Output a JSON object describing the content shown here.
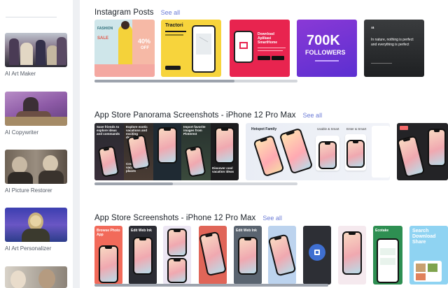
{
  "sidebar": {
    "items": [
      {
        "label": "AI Art Maker"
      },
      {
        "label": "AI Copywriter"
      },
      {
        "label": "AI Picture Restorer"
      },
      {
        "label": "AI Art Personalizer"
      },
      {
        "label": ""
      }
    ]
  },
  "sections": [
    {
      "title": "Instagram Posts",
      "see_all": "See all",
      "cards": {
        "fashion_sale": {
          "tag": "FASHION",
          "sub": "SALE",
          "discount": "40%",
          "off": "OFF"
        },
        "tractori": {
          "brand": "Tractori"
        },
        "download": {
          "headline": "Download Aplikasi SmartHome"
        },
        "followers": {
          "count": "700K",
          "label": "FOLLOWERS"
        },
        "quote": {
          "text": "In nature, nothing is perfect and everything is perfect"
        }
      }
    },
    {
      "title": "App Store Panorama Screenshots - iPhone 12 Pro Max",
      "see_all": "See all",
      "cards": {
        "panel_texts": [
          "Save friends to explore ideas and commands",
          "Explore exotic vacations and exciting destinations",
          "Import favorite images from Pinterest",
          "Create new vacations and places",
          "Discover cool vacation ideas"
        ],
        "hotspot": "Hotspot Family",
        "bubble_labels": [
          "Usable & Smart",
          "Enter & Smart"
        ]
      }
    },
    {
      "title": "App Store Screenshots - iPhone 12 Pro Max",
      "see_all": "See all",
      "cards": {
        "labels": [
          "Browse Photo App",
          "Edit Web Ink",
          "Edit Web Ink",
          "Ecotake",
          "Search Download Share"
        ]
      }
    }
  ],
  "colors": {
    "accent_link": "#6b7bd6",
    "scroll_thumb": "#9da3ad",
    "scroll_track": "#d3d6db"
  }
}
